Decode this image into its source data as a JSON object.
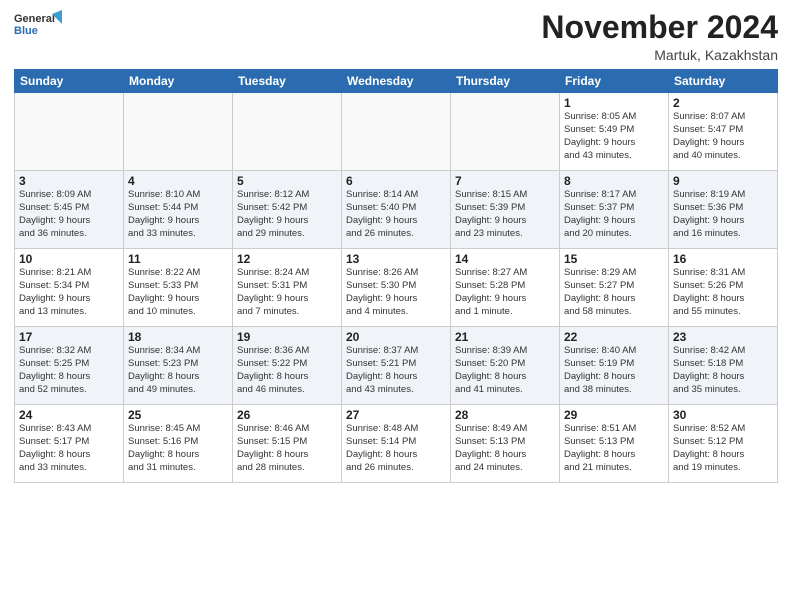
{
  "header": {
    "logo_general": "General",
    "logo_blue": "Blue",
    "month_title": "November 2024",
    "location": "Martuk, Kazakhstan"
  },
  "days_of_week": [
    "Sunday",
    "Monday",
    "Tuesday",
    "Wednesday",
    "Thursday",
    "Friday",
    "Saturday"
  ],
  "weeks": [
    {
      "alt": false,
      "days": [
        {
          "num": "",
          "info": ""
        },
        {
          "num": "",
          "info": ""
        },
        {
          "num": "",
          "info": ""
        },
        {
          "num": "",
          "info": ""
        },
        {
          "num": "",
          "info": ""
        },
        {
          "num": "1",
          "info": "Sunrise: 8:05 AM\nSunset: 5:49 PM\nDaylight: 9 hours\nand 43 minutes."
        },
        {
          "num": "2",
          "info": "Sunrise: 8:07 AM\nSunset: 5:47 PM\nDaylight: 9 hours\nand 40 minutes."
        }
      ]
    },
    {
      "alt": true,
      "days": [
        {
          "num": "3",
          "info": "Sunrise: 8:09 AM\nSunset: 5:45 PM\nDaylight: 9 hours\nand 36 minutes."
        },
        {
          "num": "4",
          "info": "Sunrise: 8:10 AM\nSunset: 5:44 PM\nDaylight: 9 hours\nand 33 minutes."
        },
        {
          "num": "5",
          "info": "Sunrise: 8:12 AM\nSunset: 5:42 PM\nDaylight: 9 hours\nand 29 minutes."
        },
        {
          "num": "6",
          "info": "Sunrise: 8:14 AM\nSunset: 5:40 PM\nDaylight: 9 hours\nand 26 minutes."
        },
        {
          "num": "7",
          "info": "Sunrise: 8:15 AM\nSunset: 5:39 PM\nDaylight: 9 hours\nand 23 minutes."
        },
        {
          "num": "8",
          "info": "Sunrise: 8:17 AM\nSunset: 5:37 PM\nDaylight: 9 hours\nand 20 minutes."
        },
        {
          "num": "9",
          "info": "Sunrise: 8:19 AM\nSunset: 5:36 PM\nDaylight: 9 hours\nand 16 minutes."
        }
      ]
    },
    {
      "alt": false,
      "days": [
        {
          "num": "10",
          "info": "Sunrise: 8:21 AM\nSunset: 5:34 PM\nDaylight: 9 hours\nand 13 minutes."
        },
        {
          "num": "11",
          "info": "Sunrise: 8:22 AM\nSunset: 5:33 PM\nDaylight: 9 hours\nand 10 minutes."
        },
        {
          "num": "12",
          "info": "Sunrise: 8:24 AM\nSunset: 5:31 PM\nDaylight: 9 hours\nand 7 minutes."
        },
        {
          "num": "13",
          "info": "Sunrise: 8:26 AM\nSunset: 5:30 PM\nDaylight: 9 hours\nand 4 minutes."
        },
        {
          "num": "14",
          "info": "Sunrise: 8:27 AM\nSunset: 5:28 PM\nDaylight: 9 hours\nand 1 minute."
        },
        {
          "num": "15",
          "info": "Sunrise: 8:29 AM\nSunset: 5:27 PM\nDaylight: 8 hours\nand 58 minutes."
        },
        {
          "num": "16",
          "info": "Sunrise: 8:31 AM\nSunset: 5:26 PM\nDaylight: 8 hours\nand 55 minutes."
        }
      ]
    },
    {
      "alt": true,
      "days": [
        {
          "num": "17",
          "info": "Sunrise: 8:32 AM\nSunset: 5:25 PM\nDaylight: 8 hours\nand 52 minutes."
        },
        {
          "num": "18",
          "info": "Sunrise: 8:34 AM\nSunset: 5:23 PM\nDaylight: 8 hours\nand 49 minutes."
        },
        {
          "num": "19",
          "info": "Sunrise: 8:36 AM\nSunset: 5:22 PM\nDaylight: 8 hours\nand 46 minutes."
        },
        {
          "num": "20",
          "info": "Sunrise: 8:37 AM\nSunset: 5:21 PM\nDaylight: 8 hours\nand 43 minutes."
        },
        {
          "num": "21",
          "info": "Sunrise: 8:39 AM\nSunset: 5:20 PM\nDaylight: 8 hours\nand 41 minutes."
        },
        {
          "num": "22",
          "info": "Sunrise: 8:40 AM\nSunset: 5:19 PM\nDaylight: 8 hours\nand 38 minutes."
        },
        {
          "num": "23",
          "info": "Sunrise: 8:42 AM\nSunset: 5:18 PM\nDaylight: 8 hours\nand 35 minutes."
        }
      ]
    },
    {
      "alt": false,
      "days": [
        {
          "num": "24",
          "info": "Sunrise: 8:43 AM\nSunset: 5:17 PM\nDaylight: 8 hours\nand 33 minutes."
        },
        {
          "num": "25",
          "info": "Sunrise: 8:45 AM\nSunset: 5:16 PM\nDaylight: 8 hours\nand 31 minutes."
        },
        {
          "num": "26",
          "info": "Sunrise: 8:46 AM\nSunset: 5:15 PM\nDaylight: 8 hours\nand 28 minutes."
        },
        {
          "num": "27",
          "info": "Sunrise: 8:48 AM\nSunset: 5:14 PM\nDaylight: 8 hours\nand 26 minutes."
        },
        {
          "num": "28",
          "info": "Sunrise: 8:49 AM\nSunset: 5:13 PM\nDaylight: 8 hours\nand 24 minutes."
        },
        {
          "num": "29",
          "info": "Sunrise: 8:51 AM\nSunset: 5:13 PM\nDaylight: 8 hours\nand 21 minutes."
        },
        {
          "num": "30",
          "info": "Sunrise: 8:52 AM\nSunset: 5:12 PM\nDaylight: 8 hours\nand 19 minutes."
        }
      ]
    }
  ]
}
